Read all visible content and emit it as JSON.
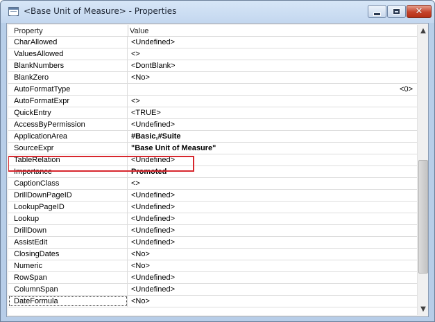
{
  "window": {
    "title": "<Base Unit of Measure> - Properties",
    "icon": "table-icon"
  },
  "columns": {
    "property": "Property",
    "value": "Value"
  },
  "rows": [
    {
      "property": "CharAllowed",
      "value": "<Undefined>"
    },
    {
      "property": "ValuesAllowed",
      "value": "<>"
    },
    {
      "property": "BlankNumbers",
      "value": "<DontBlank>"
    },
    {
      "property": "BlankZero",
      "value": "<No>"
    },
    {
      "property": "AutoFormatType",
      "value": "<0>"
    },
    {
      "property": "AutoFormatExpr",
      "value": "<>"
    },
    {
      "property": "QuickEntry",
      "value": "<TRUE>"
    },
    {
      "property": "AccessByPermission",
      "value": "<Undefined>"
    },
    {
      "property": "ApplicationArea",
      "value": "#Basic,#Suite"
    },
    {
      "property": "SourceExpr",
      "value": "\"Base Unit of Measure\""
    },
    {
      "property": "TableRelation",
      "value": "<Undefined>"
    },
    {
      "property": "Importance",
      "value": "Promoted"
    },
    {
      "property": "CaptionClass",
      "value": "<>"
    },
    {
      "property": "DrillDownPageID",
      "value": "<Undefined>"
    },
    {
      "property": "LookupPageID",
      "value": "<Undefined>"
    },
    {
      "property": "Lookup",
      "value": "<Undefined>"
    },
    {
      "property": "DrillDown",
      "value": "<Undefined>"
    },
    {
      "property": "AssistEdit",
      "value": "<Undefined>"
    },
    {
      "property": "ClosingDates",
      "value": "<No>"
    },
    {
      "property": "Numeric",
      "value": "<No>"
    },
    {
      "property": "RowSpan",
      "value": "<Undefined>"
    },
    {
      "property": "ColumnSpan",
      "value": "<Undefined>"
    },
    {
      "property": "DateFormula",
      "value": "<No>"
    }
  ],
  "highlight_color": "#d7262d"
}
